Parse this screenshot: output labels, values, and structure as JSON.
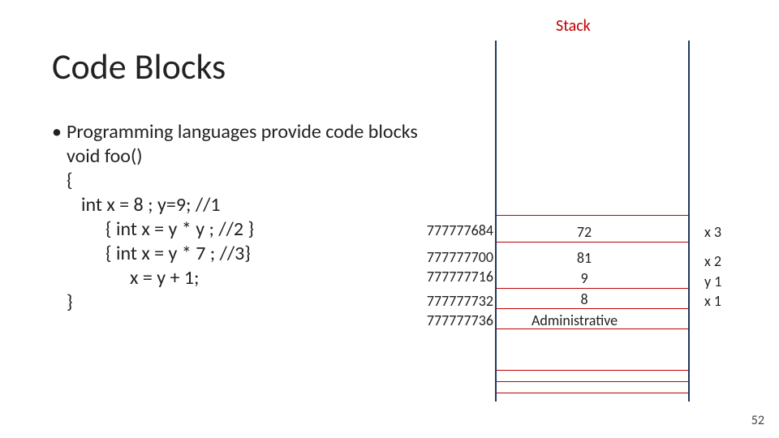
{
  "header": {
    "stack_label": "Stack",
    "title": "Code Blocks"
  },
  "content": {
    "line1": "Programming  languages provide code blocks",
    "line2": "void foo()",
    "line3": "{",
    "line4": "int x = 8 ; y=9; //1",
    "line5": "{ int x = y * y ; //2 }",
    "line6": "{ int x = y * 7 ; //3}",
    "line7": "x = y + 1;",
    "line8": "}"
  },
  "stack": {
    "addresses": [
      "777777684",
      "777777700",
      "777777716",
      "777777732",
      "777777736"
    ],
    "values": [
      "72",
      "81",
      "9",
      "8"
    ],
    "vars": [
      "x 3",
      "x 2",
      "y 1",
      "x 1"
    ],
    "admin_label": "Administrative"
  },
  "page_number": "52"
}
